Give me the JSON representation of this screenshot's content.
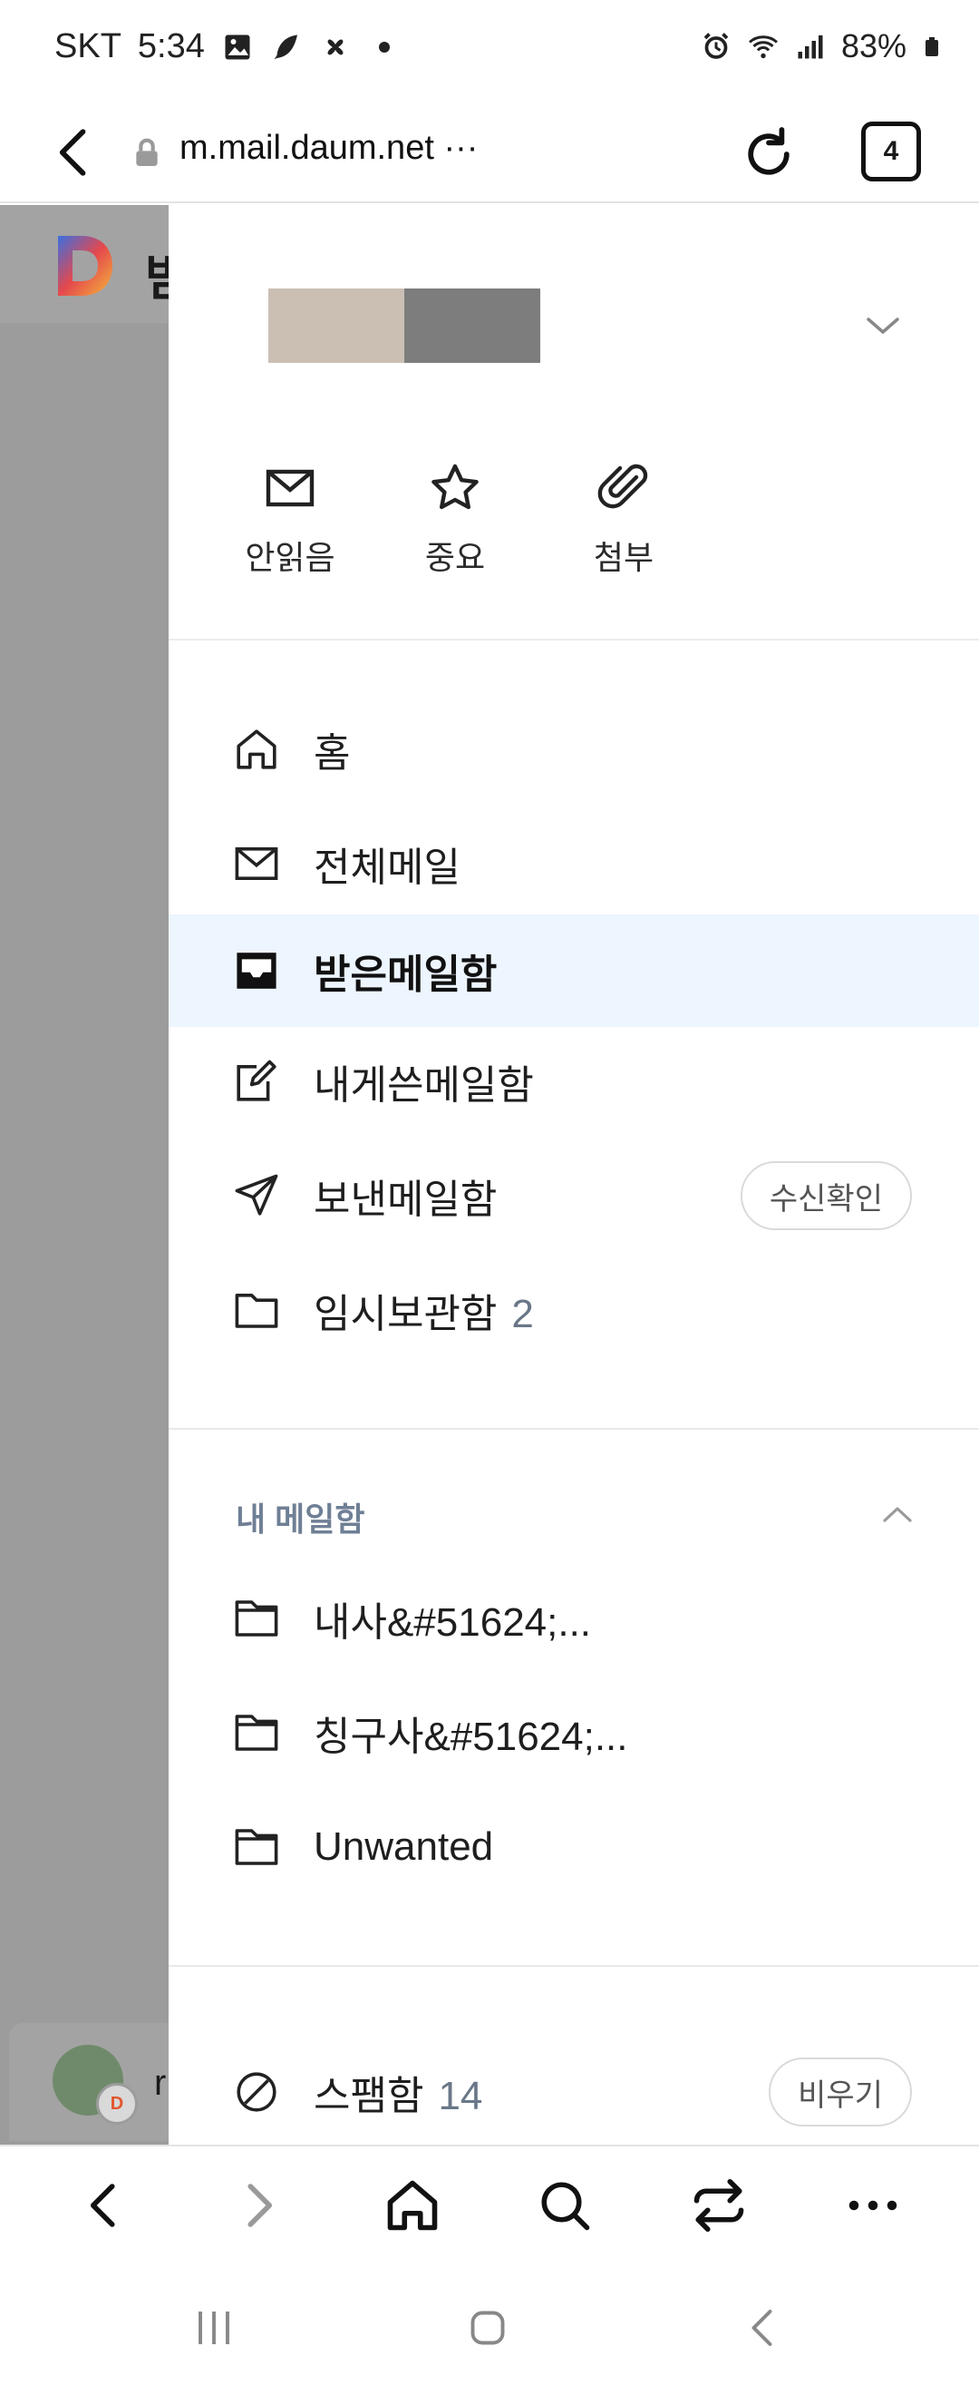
{
  "status_bar": {
    "carrier": "SKT",
    "time": "5:34",
    "battery": "83%",
    "left_icons": [
      "gallery-icon",
      "feather-icon",
      "pinwheel-icon",
      "dot-icon"
    ],
    "right_icons": [
      "alarm-icon",
      "wifi-icon",
      "signal-icon",
      "battery-icon"
    ]
  },
  "browser": {
    "url": "m.mail.daum.net",
    "url_more": "···",
    "tab_count": "4"
  },
  "background_page": {
    "title_fragment": "받",
    "row_fragment": "r",
    "badge_letter": "D"
  },
  "drawer": {
    "quick_actions": [
      {
        "label": "안읽음",
        "icon": "envelope-icon"
      },
      {
        "label": "중요",
        "icon": "star-icon"
      },
      {
        "label": "첨부",
        "icon": "paperclip-icon"
      }
    ],
    "main_menu": [
      {
        "label": "홈",
        "icon": "home-icon",
        "count": ""
      },
      {
        "label": "전체메일",
        "icon": "envelope-icon",
        "count": ""
      },
      {
        "label": "받은메일함",
        "icon": "inbox-icon",
        "count": "",
        "active": true
      },
      {
        "label": "내게쓴메일함",
        "icon": "edit-note-icon",
        "count": ""
      },
      {
        "label": "보낸메일함",
        "icon": "send-icon",
        "count": "",
        "pill": "수신확인"
      },
      {
        "label": "임시보관함",
        "icon": "folder-icon",
        "count": "2"
      }
    ],
    "my_mailboxes": {
      "section_title": "내 메일함",
      "items": [
        {
          "label": "내사&#51624;...",
          "icon": "folder-icon"
        },
        {
          "label": "칭구사&#51624;...",
          "icon": "folder-icon"
        },
        {
          "label": "Unwanted",
          "icon": "folder-icon"
        }
      ]
    },
    "spam": {
      "label": "스팸함",
      "count": "14",
      "icon": "block-icon",
      "pill": "비우기"
    }
  },
  "toolbar": {
    "buttons": [
      "back-icon",
      "forward-icon",
      "home-icon",
      "search-icon",
      "tabs-switch-icon",
      "more-icon"
    ]
  },
  "system_nav": {
    "buttons": [
      "recents-icon",
      "home-icon",
      "back-icon"
    ]
  },
  "colors": {
    "active_row": "#edf5fe",
    "section_label": "#6f7f95",
    "count_text": "#6a7788",
    "scrim": "#9c9c9c"
  }
}
